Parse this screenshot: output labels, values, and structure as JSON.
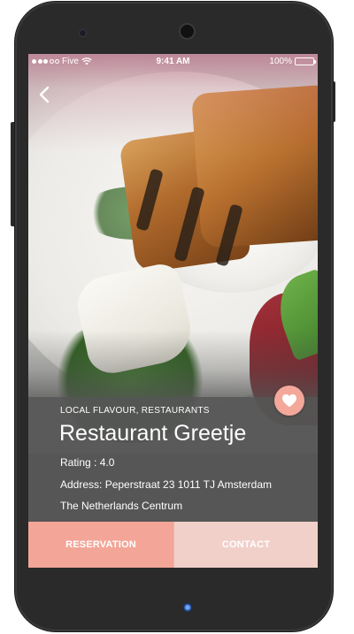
{
  "status_bar": {
    "carrier": "Five",
    "time": "9:41 AM",
    "battery": "100%"
  },
  "restaurant": {
    "category": "LOCAL FLAVOUR, RESTAURANTS",
    "name": "Restaurant Greetje",
    "rating_text": "Rating : 4.0",
    "address_line1": "Address: Peperstraat 23 1011 TJ Amsterdam",
    "address_line2": "The Netherlands Centrum"
  },
  "actions": {
    "reservation_label": "RESERVATION",
    "contact_label": "CONTACT"
  },
  "icons": {
    "back": "chevron-left-icon",
    "favorite": "heart-icon",
    "wifi": "wifi-icon",
    "battery": "battery-icon"
  },
  "colors": {
    "accent": "#f3a597",
    "accent_light": "#f1d0c9",
    "panel": "#555555"
  }
}
